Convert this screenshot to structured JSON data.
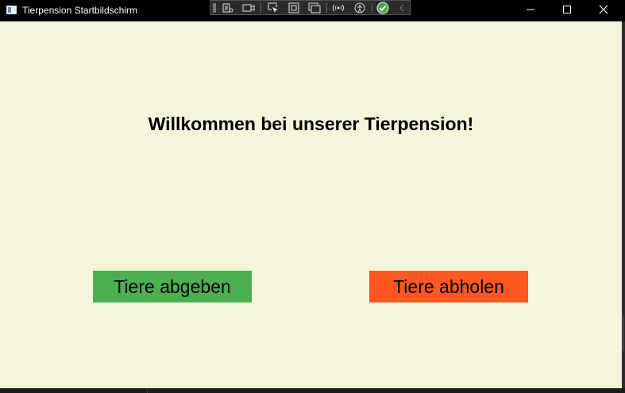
{
  "window": {
    "title": "Tierpension Startbildschirm"
  },
  "dev_toolbar": {
    "icons": [
      "live-tree-icon",
      "record-icon",
      "select-element-icon",
      "layout-adorners-icon",
      "track-focus-icon",
      "hot-reload-icon",
      "accessibility-icon",
      "checkmark-icon",
      "collapse-chevron-icon"
    ]
  },
  "window_controls": {
    "minimize": "minimize-icon",
    "maximize": "maximize-icon",
    "close": "close-icon"
  },
  "main": {
    "welcome_text": "Willkommen bei unserer Tierpension!",
    "drop_off_label": "Tiere abgeben",
    "pick_up_label": "Tiere abholen"
  },
  "colors": {
    "background": "#f5f5dc",
    "drop_off_button": "#4caf50",
    "pick_up_button": "#ff5722",
    "title_bar": "#000000"
  }
}
